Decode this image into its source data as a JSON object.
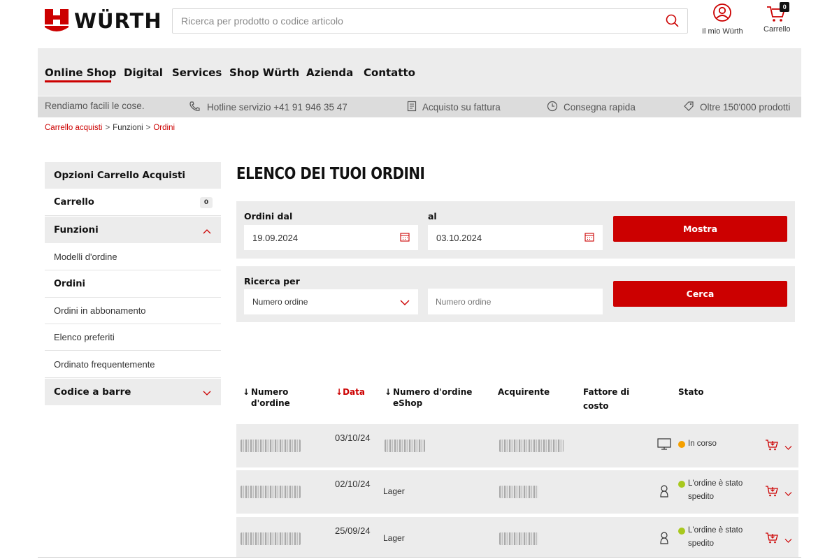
{
  "header": {
    "logo_text": "WÜRTH",
    "search_placeholder": "Ricerca per prodotto o codice articolo",
    "account_label": "Il mio Würth",
    "cart_label": "Carrello",
    "cart_count": "0"
  },
  "nav": {
    "items": [
      "Online Shop",
      "Digital",
      "Services",
      "Shop Würth",
      "Azienda",
      "Contatto"
    ],
    "active_index": 0
  },
  "benefits": {
    "tagline": "Rendiamo facili le cose.",
    "hotline": "Hotline servizio +41 91 946 35 47",
    "invoice": "Acquisto su fattura",
    "delivery": "Consegna rapida",
    "products": "Oltre 150'000 prodotti"
  },
  "breadcrumb": {
    "items": [
      "Carrello acquisti",
      "Funzioni",
      "Ordini"
    ],
    "separator": ">"
  },
  "sidebar": {
    "heading": "Opzioni Carrello Acquisti",
    "cart_label": "Carrello",
    "cart_badge": "0",
    "functions_label": "Funzioni",
    "items": [
      "Modelli d'ordine",
      "Ordini",
      "Ordini in abbonamento",
      "Elenco preferiti",
      "Ordinato frequentemente"
    ],
    "active_item": "Ordini",
    "barcode_label": "Codice a barre"
  },
  "main": {
    "title": "ELENCO DEI TUOI ORDINI",
    "date_filter": {
      "from_label": "Ordini dal",
      "from_value": "19.09.2024",
      "to_label": "al",
      "to_value": "03.10.2024",
      "button": "Mostra"
    },
    "search_filter": {
      "label": "Ricerca per",
      "select_value": "Numero ordine",
      "input_placeholder": "Numero ordine",
      "button": "Cerca"
    },
    "table": {
      "headers": {
        "order_number": "Numero d'ordine",
        "date": "Data",
        "eshop_number": "Numero d'ordine eShop",
        "buyer": "Acquirente",
        "cost_factor": "Fattore di costo",
        "status": "Stato"
      },
      "rows": [
        {
          "date": "03/10/24",
          "eshop": "",
          "status": "In corso",
          "status_color": "#f5a000",
          "channel": "desktop-icon"
        },
        {
          "date": "02/10/24",
          "eshop": "Lager",
          "status": "L'ordine è stato spedito",
          "status_color": "#a8c81e",
          "channel": "person-icon"
        },
        {
          "date": "25/09/24",
          "eshop": "Lager",
          "status": "L'ordine è stato spedito",
          "status_color": "#a8c81e",
          "channel": "person-icon"
        }
      ]
    }
  },
  "colors": {
    "brand_red": "#cc0000",
    "panel_grey": "#ececec",
    "band_grey": "#dcdcdc"
  }
}
